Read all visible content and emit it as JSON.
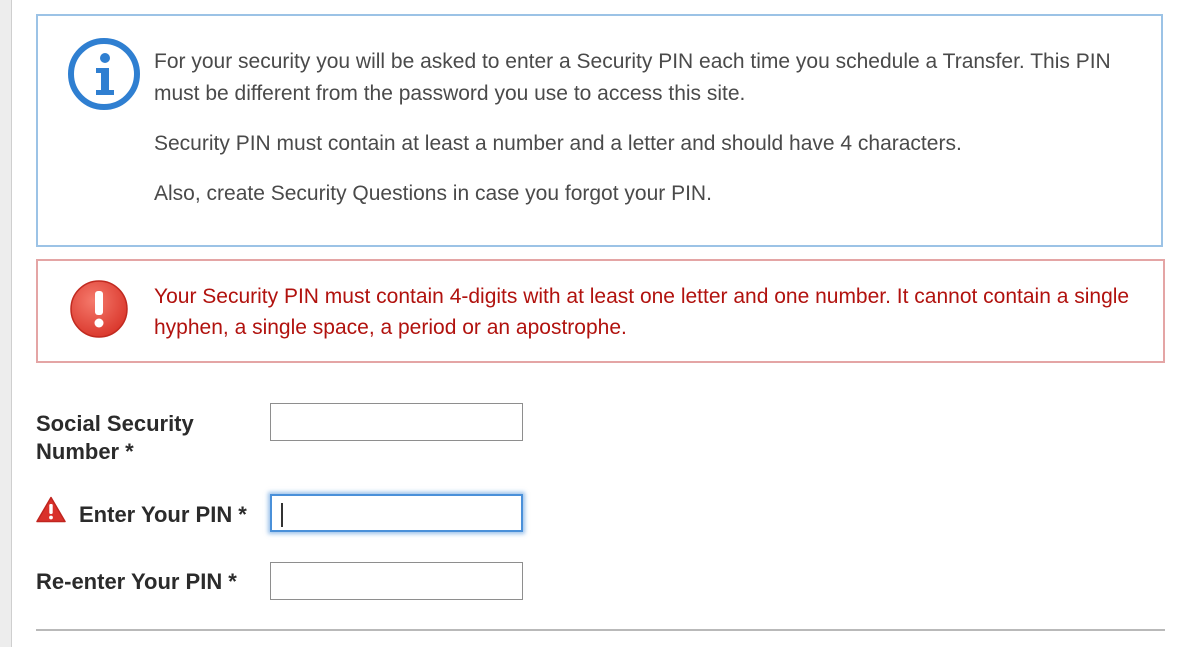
{
  "info": {
    "icon": "info-icon",
    "paragraphs": [
      "For your security you will be asked to enter a Security PIN each time you schedule a Transfer. This PIN must be different from the password you use to access this site.",
      "Security PIN must contain at least a number and a letter and should have 4 characters.",
      "Also, create Security Questions in case you forgot your PIN."
    ]
  },
  "error": {
    "icon": "exclamation-icon",
    "message": "Your Security PIN must contain 4-digits with at least one letter and one number. It cannot contain a single hyphen, a single space, a period or an apostrophe.",
    "color": "#b1120e"
  },
  "form": {
    "ssn": {
      "label_line1": "Social Security",
      "label_line2": "Number",
      "required_mark": "*",
      "value": ""
    },
    "pin": {
      "label": "Enter Your PIN",
      "required_mark": "*",
      "value": "",
      "focused": true,
      "warning_icon": "warning-triangle-icon"
    },
    "pin_confirm": {
      "label": "Re-enter Your PIN",
      "required_mark": "*",
      "value": ""
    }
  },
  "colors": {
    "info_border": "#9cc3e6",
    "info_icon": "#2f7fd1",
    "error_border": "#e4a5a5",
    "error_icon": "#e2463a",
    "focus_ring": "#4a90d9"
  }
}
